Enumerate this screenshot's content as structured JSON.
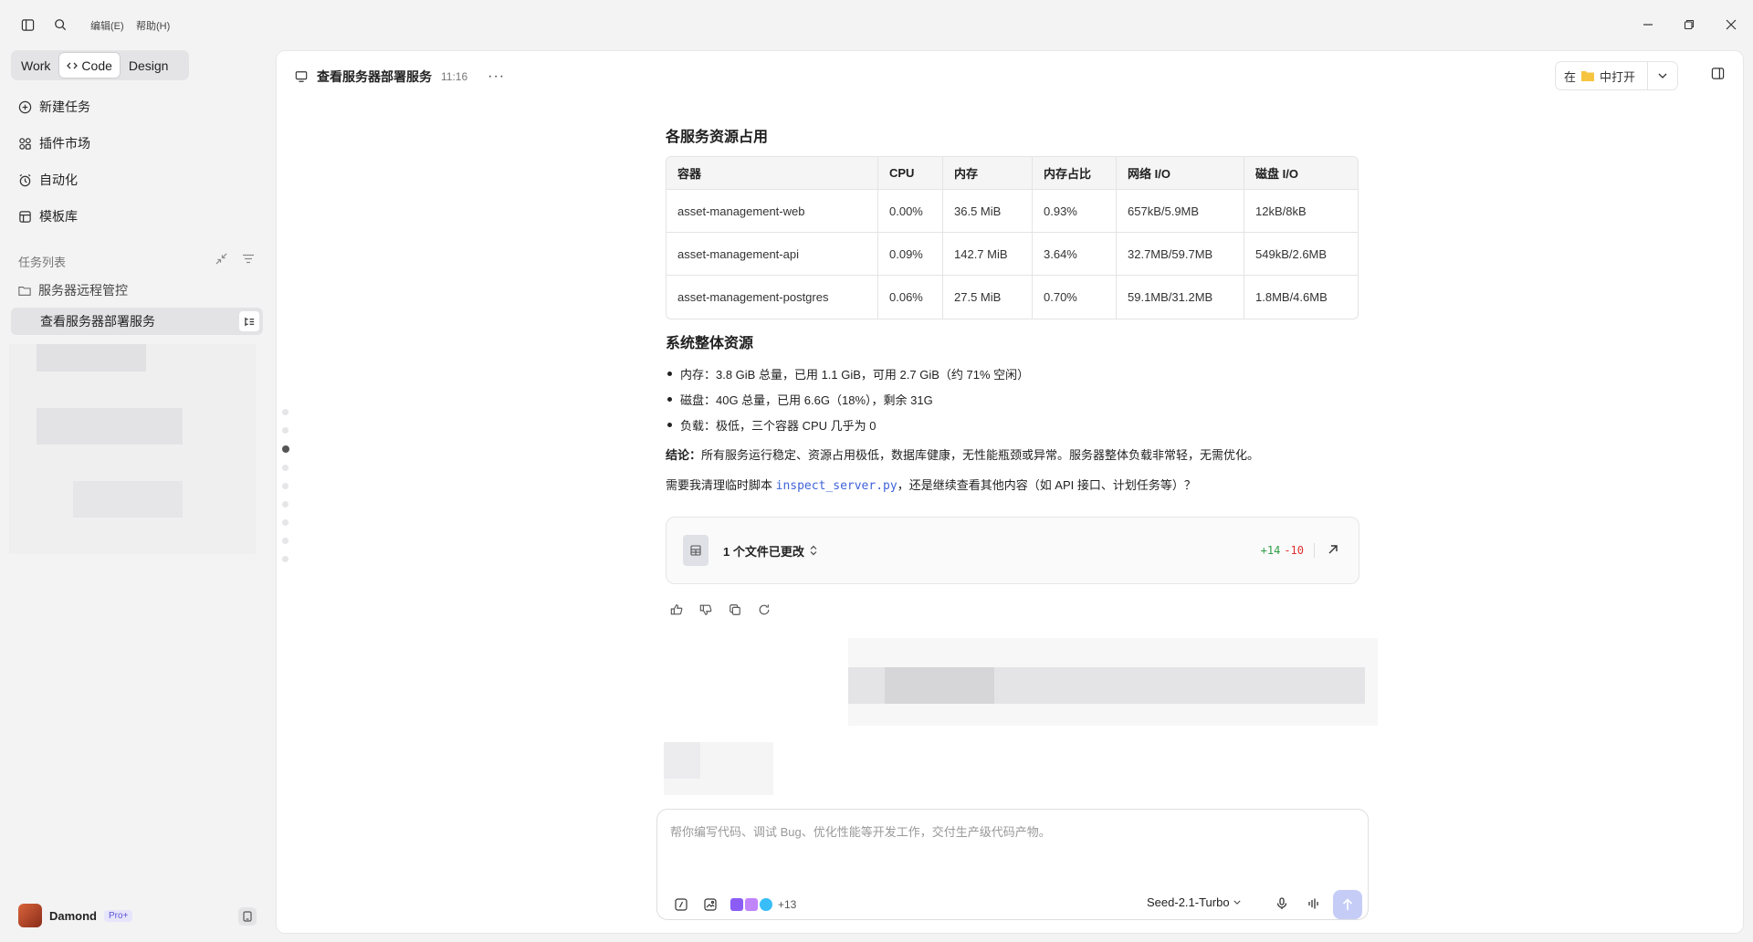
{
  "menu": {
    "edit": "编辑(E)",
    "help": "帮助(H)"
  },
  "modes": [
    {
      "label": "Work"
    },
    {
      "label": "Code"
    },
    {
      "label": "Design"
    }
  ],
  "nav": {
    "new_task": "新建任务",
    "plugins": "插件市场",
    "automation": "自动化",
    "templates": "模板库"
  },
  "tasks": {
    "section_label": "任务列表",
    "folder": "服务器远程管控",
    "active_task": "查看服务器部署服务"
  },
  "user": {
    "name": "Damond",
    "badge": "Pro+"
  },
  "header": {
    "title": "查看服务器部署服务",
    "time": "11:16",
    "open_prefix": "在",
    "open_suffix": "中打开"
  },
  "content": {
    "heading_services": "各服务资源占用",
    "table": {
      "headers": [
        "容器",
        "CPU",
        "内存",
        "内存占比",
        "网络 I/O",
        "磁盘 I/O"
      ],
      "rows": [
        [
          "asset-management-web",
          "0.00%",
          "36.5 MiB",
          "0.93%",
          "657kB/5.9MB",
          "12kB/8kB"
        ],
        [
          "asset-management-api",
          "0.09%",
          "142.7 MiB",
          "3.64%",
          "32.7MB/59.7MB",
          "549kB/2.6MB"
        ],
        [
          "asset-management-postgres",
          "0.06%",
          "27.5 MiB",
          "0.70%",
          "59.1MB/31.2MB",
          "1.8MB/4.6MB"
        ]
      ]
    },
    "heading_system": "系统整体资源",
    "bullets": [
      "内存：3.8 GiB 总量，已用 1.1 GiB，可用 2.7 GiB（约 71% 空闲）",
      "磁盘：40G 总量，已用 6.6G（18%），剩余 31G",
      "负载：极低，三个容器 CPU 几乎为 0"
    ],
    "conclusion_label": "结论：",
    "conclusion_text": "所有服务运行稳定、资源占用极低，数据库健康，无性能瓶颈或异常。服务器整体负载非常轻，无需优化。",
    "question_prefix": "需要我清理临时脚本 ",
    "question_code": "inspect_server.py",
    "question_suffix": "，还是继续查看其他内容（如 API 接口、计划任务等）？",
    "files_changed": "1 个文件已更改",
    "diff_add": "+14",
    "diff_del": "-10"
  },
  "composer": {
    "placeholder": "帮你编写代码、调试 Bug、优化性能等开发工作，交付生产级代码产物。",
    "plugin_more": "+13",
    "model": "Seed-2.1-Turbo"
  },
  "colors": {
    "accent": "#3f63d8",
    "send": "#c5cdf7",
    "diff_add": "#2f9e44",
    "diff_del": "#e03131"
  }
}
